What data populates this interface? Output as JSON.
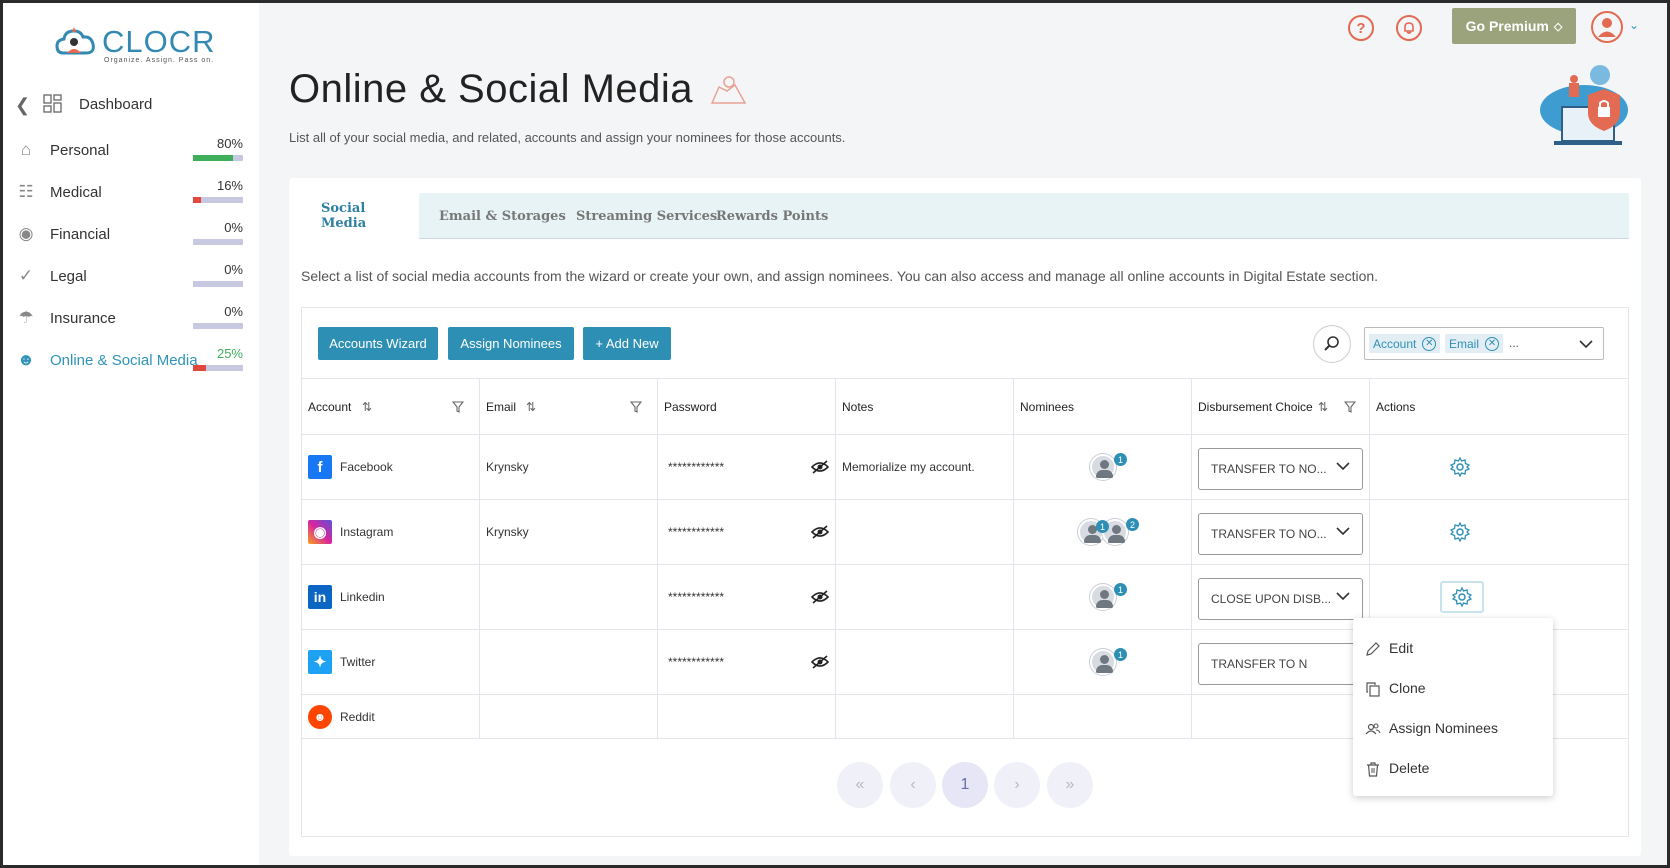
{
  "brand": {
    "name": "CLOCR",
    "tagline": "Organize. Assign. Pass on."
  },
  "sidebar": {
    "dashboard_label": "Dashboard",
    "items": [
      {
        "label": "Personal",
        "percent_text": "80%",
        "percent": 80,
        "bar_color": "#3fae5b"
      },
      {
        "label": "Medical",
        "percent_text": "16%",
        "percent": 16,
        "bar_color": "#e2473f"
      },
      {
        "label": "Financial",
        "percent_text": "0%",
        "percent": 0,
        "bar_color": "#e2473f"
      },
      {
        "label": "Legal",
        "percent_text": "0%",
        "percent": 0,
        "bar_color": "#e2473f"
      },
      {
        "label": "Insurance",
        "percent_text": "0%",
        "percent": 0,
        "bar_color": "#e2473f"
      },
      {
        "label": "Online & Social Media",
        "percent_text": "25%",
        "percent": 25,
        "bar_color": "#e2473f"
      }
    ]
  },
  "header": {
    "premium_label": "Go Premium",
    "help_icon": "help-icon",
    "notification_icon": "bell-icon"
  },
  "page": {
    "title": "Online & Social Media",
    "subtitle": "List all of your social media, and related, accounts and assign your nominees for those accounts."
  },
  "tabs": [
    "Social Media",
    "Email & Storages",
    "Streaming Services",
    "Rewards Points"
  ],
  "description": "Select a list of social media accounts from the wizard or create your own, and assign nominees. You can also access and manage all online accounts in Digital Estate section.",
  "toolbar": {
    "wizard_label": "Accounts Wizard",
    "assign_label": "Assign Nominees",
    "add_label": "+ Add New",
    "chips": [
      "Account",
      "Email"
    ],
    "chips_more": "..."
  },
  "table": {
    "headers": [
      "Account",
      "Email",
      "Password",
      "Notes",
      "Nominees",
      "Disbursement Choice",
      "Actions"
    ],
    "rows": [
      {
        "account": "Facebook",
        "email": "Krynsky",
        "password": "************",
        "notes": "Memorialize my account.",
        "nominees": 1,
        "disbursement": "TRANSFER TO NO...",
        "icon": "facebook-icon",
        "icon_color": "#1877f2"
      },
      {
        "account": "Instagram",
        "email": "Krynsky",
        "password": "************",
        "notes": "",
        "nominees": 2,
        "disbursement": "TRANSFER TO NO...",
        "icon": "instagram-icon",
        "icon_color": "#d6249f"
      },
      {
        "account": "Linkedin",
        "email": "",
        "password": "************",
        "notes": "",
        "nominees": 1,
        "disbursement": "CLOSE UPON DISB...",
        "icon": "linkedin-icon",
        "icon_color": "#0a66c2"
      },
      {
        "account": "Twitter",
        "email": "",
        "password": "************",
        "notes": "",
        "nominees": 1,
        "disbursement": "TRANSFER TO N",
        "icon": "twitter-icon",
        "icon_color": "#1da1f2"
      },
      {
        "account": "Reddit",
        "email": "",
        "password": "",
        "notes": "",
        "nominees": 0,
        "disbursement": "",
        "icon": "reddit-icon",
        "icon_color": "#ff4500"
      }
    ]
  },
  "pagination": {
    "current": "1"
  },
  "action_menu": [
    "Edit",
    "Clone",
    "Assign Nominees",
    "Delete"
  ],
  "colors": {
    "accent": "#2e8fb5",
    "premium": "#9ba37d",
    "header_icon": "#e36a53"
  }
}
